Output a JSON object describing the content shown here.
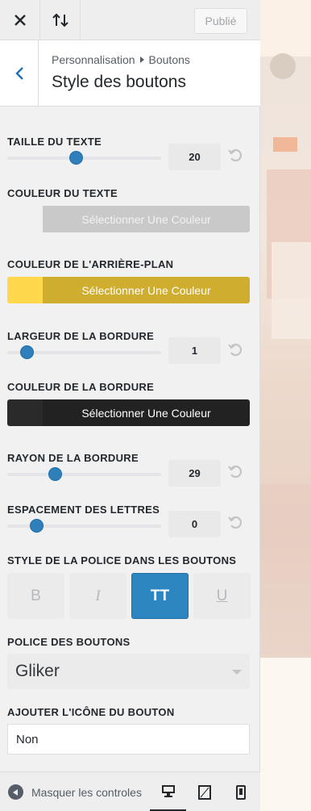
{
  "header": {
    "close_icon": "close-icon",
    "sort_icon": "sort-arrows-icon",
    "publish_label": "Publié"
  },
  "section": {
    "breadcrumb_parent": "Personnalisation",
    "breadcrumb_child": "Boutons",
    "title": "Style des boutons"
  },
  "controls": {
    "text_size": {
      "label": "TAILLE DU TEXTE",
      "value": "20",
      "fraction": 0.45
    },
    "text_color": {
      "label": "COULEUR DU TEXTE",
      "button": "Sélectionner Une Couleur",
      "swatch": "#ffffff",
      "bg": "#c9c9c9",
      "fg": "#f2f2f2"
    },
    "bg_color": {
      "label": "COULEUR DE L'ARRIÈRE-PLAN",
      "button": "Sélectionner Une Couleur",
      "swatch": "#ffd84d",
      "bg": "#cfad2e",
      "fg": "#ffffff"
    },
    "border_width": {
      "label": "LARGEUR DE LA BORDURE",
      "value": "1",
      "fraction": 0.13
    },
    "border_color": {
      "label": "COULEUR DE LA BORDURE",
      "button": "Sélectionner Une Couleur",
      "swatch": "#2a2a2a",
      "bg": "#222222",
      "fg": "#ffffff"
    },
    "border_radius": {
      "label": "RAYON DE LA BORDURE",
      "value": "29",
      "fraction": 0.31
    },
    "letter_spacing": {
      "label": "ESPACEMENT DES LETTRES",
      "value": "0",
      "fraction": 0.19
    },
    "font_style": {
      "label": "STYLE DE LA POLICE DANS LES BOUTONS",
      "options": [
        "B",
        "I",
        "TT",
        "U"
      ],
      "active": "TT"
    },
    "font": {
      "label": "POLICE DES BOUTONS",
      "value": "Gliker"
    },
    "icon": {
      "label": "AJOUTER L'ICÔNE DU BOUTON",
      "value": "Non"
    }
  },
  "footer": {
    "collapse_label": "Masquer les controles",
    "devices": [
      "desktop-icon",
      "tablet-icon",
      "mobile-icon"
    ]
  },
  "colors": {
    "accent": "#2e86c1"
  }
}
